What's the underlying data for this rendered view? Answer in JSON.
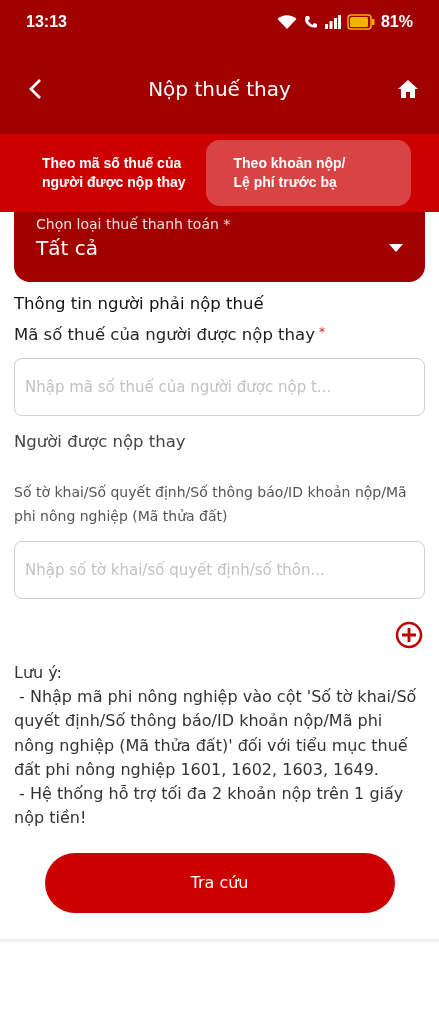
{
  "status_bar": {
    "time": "13:13",
    "battery": "81%"
  },
  "header": {
    "title": "Nộp thuế thay"
  },
  "tabs": [
    {
      "label": "Theo mã số thuế của\nngười được nộp thay",
      "selected": false
    },
    {
      "label": "Theo khoản nộp/\nLệ phí trước bạ",
      "selected": true
    }
  ],
  "tax_type_select": {
    "label": "Chọn loại thuế thanh toán",
    "required_mark": "*",
    "value": "Tất cả"
  },
  "section_title": "Thông tin người phải nộp thuế",
  "tax_code_field": {
    "label": "Mã số thuế của người được nộp thay",
    "required_mark": "*",
    "placeholder": "Nhập mã số thuế của người được nộp t..."
  },
  "payer_label": "Người được nộp thay",
  "document_field": {
    "label": "Số tờ khai/Số quyết định/Số thông báo/ID khoản nộp/Mã phi nông nghiệp (Mã thửa đất)",
    "placeholder": "Nhập số tờ khai/số quyết định/số thôn..."
  },
  "note": [
    "Lưu ý:",
    " - Nhập mã phi nông nghiệp vào cột 'Số tờ khai/Số quyết định/Số thông báo/ID khoản nộp/Mã phi nông nghiệp (Mã thửa đất)' đối với tiểu mục thuế đất phi nông nghiệp 1601, 1602, 1603, 1649.",
    " - Hệ thống hỗ trợ tối đa 2 khoản nộp trên 1 giấy nộp tiền!"
  ],
  "submit_button": "Tra cứu"
}
